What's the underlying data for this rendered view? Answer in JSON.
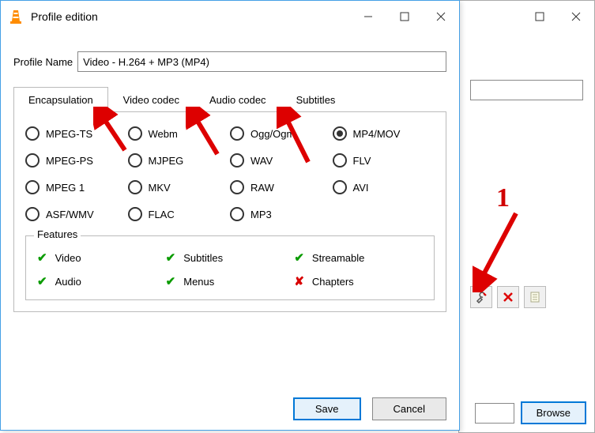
{
  "dialog": {
    "title": "Profile edition",
    "profile_name_label": "Profile Name",
    "profile_name_value": "Video - H.264 + MP3 (MP4)",
    "tabs": {
      "encapsulation": "Encapsulation",
      "video_codec": "Video codec",
      "audio_codec": "Audio codec",
      "subtitles": "Subtitles"
    },
    "radios": {
      "mpeg_ts": "MPEG-TS",
      "webm": "Webm",
      "ogg": "Ogg/Ogm",
      "mp4": "MP4/MOV",
      "mpeg_ps": "MPEG-PS",
      "mjpeg": "MJPEG",
      "wav": "WAV",
      "flv": "FLV",
      "mpeg1": "MPEG 1",
      "mkv": "MKV",
      "raw": "RAW",
      "avi": "AVI",
      "asf": "ASF/WMV",
      "flac": "FLAC",
      "mp3": "MP3",
      "selected": "mp4"
    },
    "features": {
      "legend": "Features",
      "video": "Video",
      "subtitles": "Subtitles",
      "streamable": "Streamable",
      "audio": "Audio",
      "menus": "Menus",
      "chapters": "Chapters"
    },
    "buttons": {
      "save": "Save",
      "cancel": "Cancel"
    }
  },
  "bg_window": {
    "browse": "Browse"
  },
  "annotations": {
    "num1": "1"
  }
}
